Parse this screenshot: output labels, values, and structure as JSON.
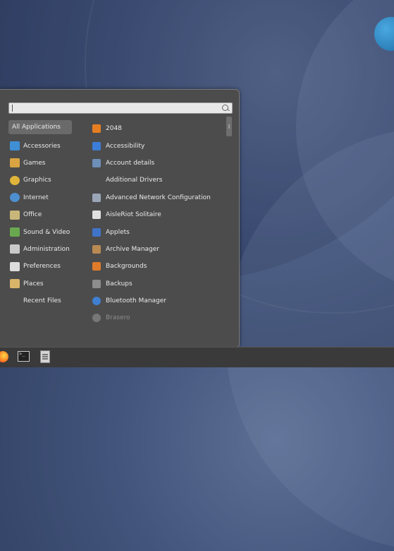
{
  "search": {
    "placeholder": ""
  },
  "categories": [
    {
      "label": "All Applications",
      "icon": "none",
      "color": ""
    },
    {
      "label": "Accessories",
      "icon": "accessories-icon",
      "color": "#3f8fd4"
    },
    {
      "label": "Games",
      "icon": "games-icon",
      "color": "#d9a441"
    },
    {
      "label": "Graphics",
      "icon": "graphics-icon",
      "color": "#e0b43a"
    },
    {
      "label": "Internet",
      "icon": "internet-icon",
      "color": "#4e8fcf"
    },
    {
      "label": "Office",
      "icon": "office-icon",
      "color": "#c9b77a"
    },
    {
      "label": "Sound & Video",
      "icon": "sound-video-icon",
      "color": "#6aa84f"
    },
    {
      "label": "Administration",
      "icon": "administration-icon",
      "color": "#c9c9c9"
    },
    {
      "label": "Preferences",
      "icon": "preferences-icon",
      "color": "#dcdcdc"
    },
    {
      "label": "Places",
      "icon": "places-icon",
      "color": "#d9b56a"
    },
    {
      "label": "Recent Files",
      "icon": "none",
      "color": ""
    }
  ],
  "apps": [
    {
      "label": "2048",
      "icon": "2048-icon",
      "color": "#e67e22"
    },
    {
      "label": "Accessibility",
      "icon": "accessibility-icon",
      "color": "#3b7dd8"
    },
    {
      "label": "Account details",
      "icon": "account-details-icon",
      "color": "#6d8fb8"
    },
    {
      "label": "Additional Drivers",
      "icon": "none",
      "color": ""
    },
    {
      "label": "Advanced Network Configuration",
      "icon": "network-icon",
      "color": "#9aa6b8"
    },
    {
      "label": "AisleRiot Solitaire",
      "icon": "solitaire-icon",
      "color": "#e0e0e0"
    },
    {
      "label": "Applets",
      "icon": "applets-icon",
      "color": "#3f74c9"
    },
    {
      "label": "Archive Manager",
      "icon": "archive-manager-icon",
      "color": "#b98a52"
    },
    {
      "label": "Backgrounds",
      "icon": "backgrounds-icon",
      "color": "#e07b2a"
    },
    {
      "label": "Backups",
      "icon": "backups-icon",
      "color": "#8d8d8d"
    },
    {
      "label": "Bluetooth Manager",
      "icon": "bluetooth-icon",
      "color": "#3f7fd1"
    },
    {
      "label": "Brasero",
      "icon": "brasero-icon",
      "color": "#777777"
    }
  ],
  "taskbar": {
    "items": [
      {
        "icon": "firefox-icon"
      },
      {
        "icon": "terminal-icon",
        "text": ">_"
      },
      {
        "icon": "files-icon"
      }
    ]
  }
}
